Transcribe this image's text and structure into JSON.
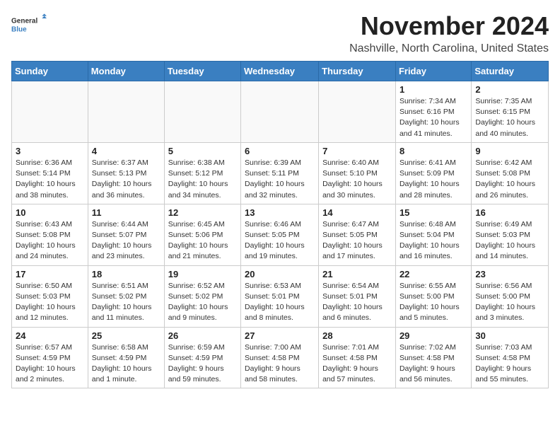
{
  "header": {
    "logo_general": "General",
    "logo_blue": "Blue",
    "month_title": "November 2024",
    "location": "Nashville, North Carolina, United States"
  },
  "days_of_week": [
    "Sunday",
    "Monday",
    "Tuesday",
    "Wednesday",
    "Thursday",
    "Friday",
    "Saturday"
  ],
  "weeks": [
    [
      {
        "day": "",
        "info": ""
      },
      {
        "day": "",
        "info": ""
      },
      {
        "day": "",
        "info": ""
      },
      {
        "day": "",
        "info": ""
      },
      {
        "day": "",
        "info": ""
      },
      {
        "day": "1",
        "info": "Sunrise: 7:34 AM\nSunset: 6:16 PM\nDaylight: 10 hours and 41 minutes."
      },
      {
        "day": "2",
        "info": "Sunrise: 7:35 AM\nSunset: 6:15 PM\nDaylight: 10 hours and 40 minutes."
      }
    ],
    [
      {
        "day": "3",
        "info": "Sunrise: 6:36 AM\nSunset: 5:14 PM\nDaylight: 10 hours and 38 minutes."
      },
      {
        "day": "4",
        "info": "Sunrise: 6:37 AM\nSunset: 5:13 PM\nDaylight: 10 hours and 36 minutes."
      },
      {
        "day": "5",
        "info": "Sunrise: 6:38 AM\nSunset: 5:12 PM\nDaylight: 10 hours and 34 minutes."
      },
      {
        "day": "6",
        "info": "Sunrise: 6:39 AM\nSunset: 5:11 PM\nDaylight: 10 hours and 32 minutes."
      },
      {
        "day": "7",
        "info": "Sunrise: 6:40 AM\nSunset: 5:10 PM\nDaylight: 10 hours and 30 minutes."
      },
      {
        "day": "8",
        "info": "Sunrise: 6:41 AM\nSunset: 5:09 PM\nDaylight: 10 hours and 28 minutes."
      },
      {
        "day": "9",
        "info": "Sunrise: 6:42 AM\nSunset: 5:08 PM\nDaylight: 10 hours and 26 minutes."
      }
    ],
    [
      {
        "day": "10",
        "info": "Sunrise: 6:43 AM\nSunset: 5:08 PM\nDaylight: 10 hours and 24 minutes."
      },
      {
        "day": "11",
        "info": "Sunrise: 6:44 AM\nSunset: 5:07 PM\nDaylight: 10 hours and 23 minutes."
      },
      {
        "day": "12",
        "info": "Sunrise: 6:45 AM\nSunset: 5:06 PM\nDaylight: 10 hours and 21 minutes."
      },
      {
        "day": "13",
        "info": "Sunrise: 6:46 AM\nSunset: 5:05 PM\nDaylight: 10 hours and 19 minutes."
      },
      {
        "day": "14",
        "info": "Sunrise: 6:47 AM\nSunset: 5:05 PM\nDaylight: 10 hours and 17 minutes."
      },
      {
        "day": "15",
        "info": "Sunrise: 6:48 AM\nSunset: 5:04 PM\nDaylight: 10 hours and 16 minutes."
      },
      {
        "day": "16",
        "info": "Sunrise: 6:49 AM\nSunset: 5:03 PM\nDaylight: 10 hours and 14 minutes."
      }
    ],
    [
      {
        "day": "17",
        "info": "Sunrise: 6:50 AM\nSunset: 5:03 PM\nDaylight: 10 hours and 12 minutes."
      },
      {
        "day": "18",
        "info": "Sunrise: 6:51 AM\nSunset: 5:02 PM\nDaylight: 10 hours and 11 minutes."
      },
      {
        "day": "19",
        "info": "Sunrise: 6:52 AM\nSunset: 5:02 PM\nDaylight: 10 hours and 9 minutes."
      },
      {
        "day": "20",
        "info": "Sunrise: 6:53 AM\nSunset: 5:01 PM\nDaylight: 10 hours and 8 minutes."
      },
      {
        "day": "21",
        "info": "Sunrise: 6:54 AM\nSunset: 5:01 PM\nDaylight: 10 hours and 6 minutes."
      },
      {
        "day": "22",
        "info": "Sunrise: 6:55 AM\nSunset: 5:00 PM\nDaylight: 10 hours and 5 minutes."
      },
      {
        "day": "23",
        "info": "Sunrise: 6:56 AM\nSunset: 5:00 PM\nDaylight: 10 hours and 3 minutes."
      }
    ],
    [
      {
        "day": "24",
        "info": "Sunrise: 6:57 AM\nSunset: 4:59 PM\nDaylight: 10 hours and 2 minutes."
      },
      {
        "day": "25",
        "info": "Sunrise: 6:58 AM\nSunset: 4:59 PM\nDaylight: 10 hours and 1 minute."
      },
      {
        "day": "26",
        "info": "Sunrise: 6:59 AM\nSunset: 4:59 PM\nDaylight: 9 hours and 59 minutes."
      },
      {
        "day": "27",
        "info": "Sunrise: 7:00 AM\nSunset: 4:58 PM\nDaylight: 9 hours and 58 minutes."
      },
      {
        "day": "28",
        "info": "Sunrise: 7:01 AM\nSunset: 4:58 PM\nDaylight: 9 hours and 57 minutes."
      },
      {
        "day": "29",
        "info": "Sunrise: 7:02 AM\nSunset: 4:58 PM\nDaylight: 9 hours and 56 minutes."
      },
      {
        "day": "30",
        "info": "Sunrise: 7:03 AM\nSunset: 4:58 PM\nDaylight: 9 hours and 55 minutes."
      }
    ]
  ]
}
